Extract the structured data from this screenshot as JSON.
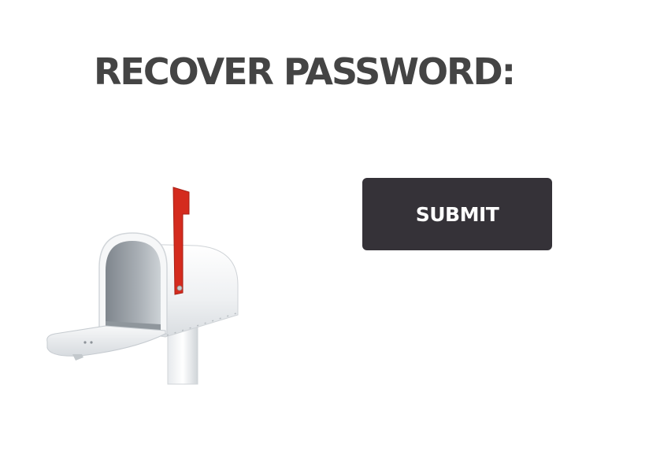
{
  "page": {
    "title": "RECOVER PASSWORD:"
  },
  "form": {
    "submit_label": "SUBMIT"
  },
  "illustration": {
    "icon": "mailbox-icon",
    "flag_color": "#d42b1e",
    "body_color": "#f1f3f5"
  },
  "colors": {
    "title_text": "#444444",
    "button_background": "#353238",
    "button_text": "#ffffff",
    "page_background": "#ffffff"
  }
}
